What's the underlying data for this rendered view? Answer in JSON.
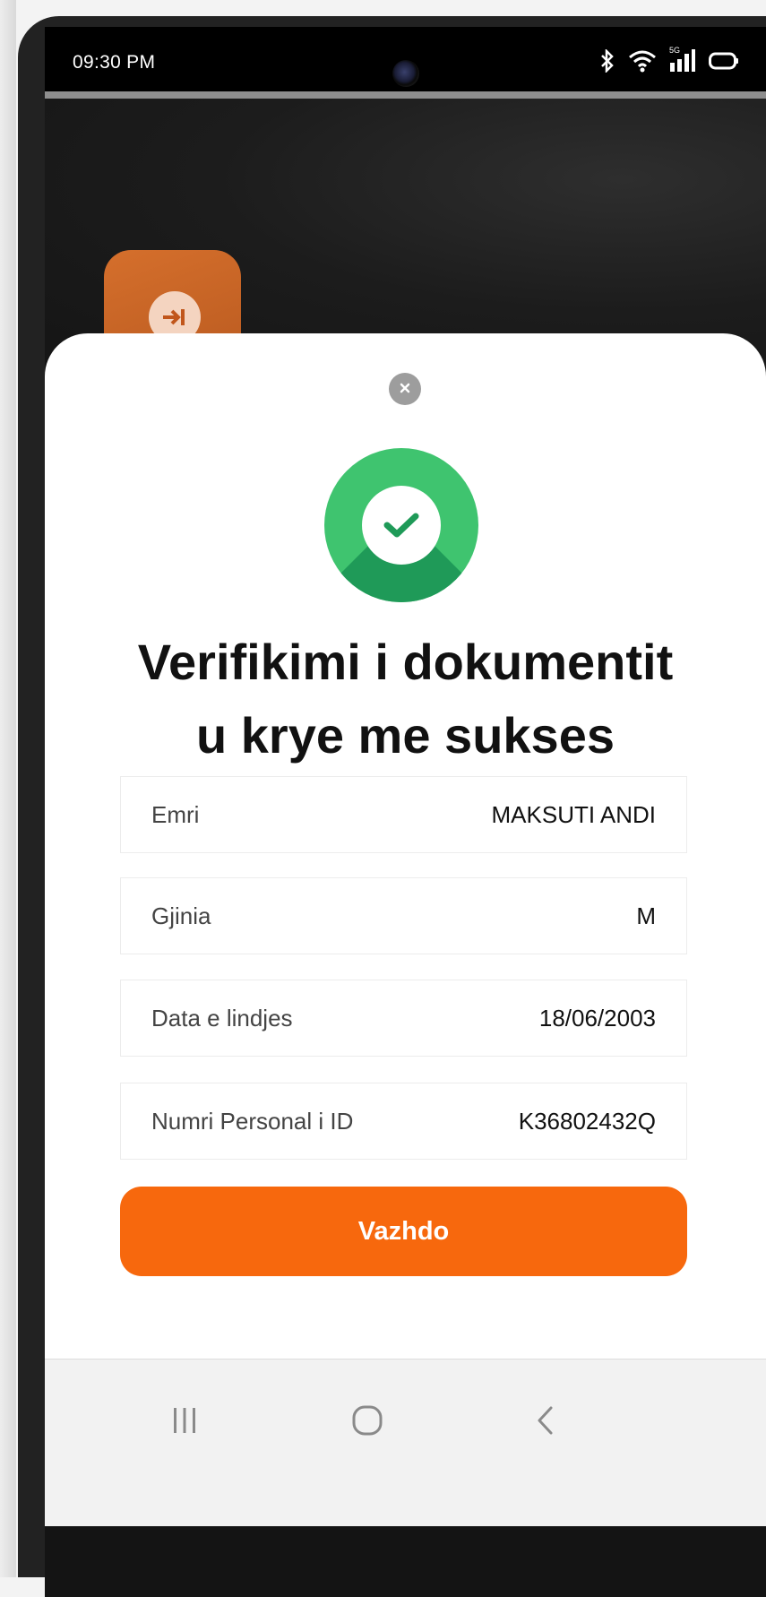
{
  "status_bar": {
    "time": "09:30 PM",
    "icons": [
      "bluetooth-icon",
      "wifi-icon",
      "5g-signal-icon",
      "battery-icon"
    ],
    "network_label": "5G"
  },
  "modal": {
    "title_line1": "Verifikimi i dokumentit",
    "title_line2": "u krye me sukses",
    "fields": [
      {
        "label": "Emri",
        "value": "MAKSUTI ANDI"
      },
      {
        "label": "Gjinia",
        "value": "M"
      },
      {
        "label": "Data e lindjes",
        "value": "18/06/2003"
      },
      {
        "label": "Numri Personal i ID",
        "value": "K36802432Q"
      }
    ],
    "continue_label": "Vazhdo"
  },
  "colors": {
    "accent": "#f7680d",
    "success": "#3fc46f",
    "success_dark": "#1f9a58",
    "app_tile": "#d56f2c"
  }
}
